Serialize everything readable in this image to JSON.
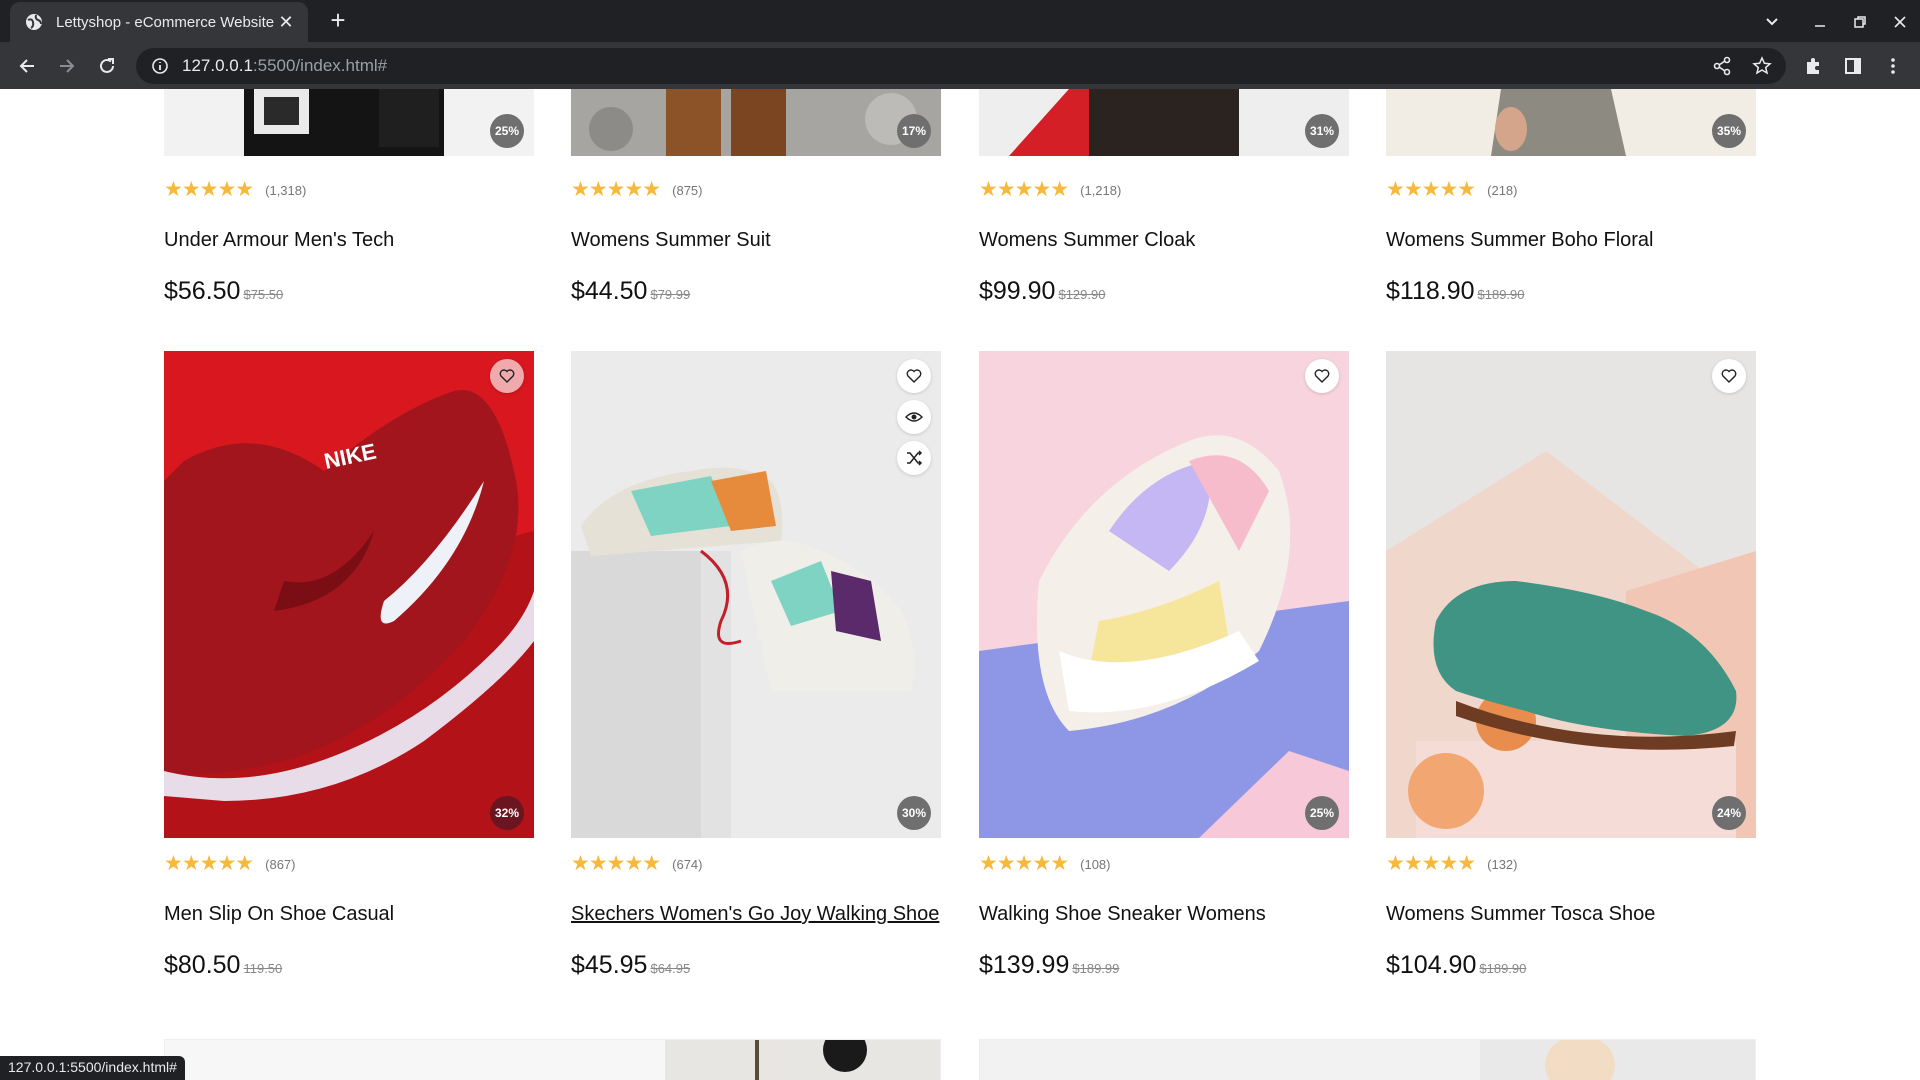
{
  "browser": {
    "tab_title": "Lettyshop - eCommerce Website",
    "url_host": "127.0.0.1",
    "url_rest": ":5500/index.html#",
    "status_url": "127.0.0.1:5500/index.html#"
  },
  "products_top": [
    {
      "reviews": "(1,318)",
      "title": "Under Armour Men's Tech",
      "price": "$56.50",
      "old_price": "$75.50",
      "discount": "25%",
      "badge_color": "#6f6f6f"
    },
    {
      "reviews": "(875)",
      "title": "Womens Summer Suit",
      "price": "$44.50",
      "old_price": "$79.99",
      "discount": "17%",
      "badge_color": "#6f6f6f"
    },
    {
      "reviews": "(1,218)",
      "title": "Womens Summer Cloak",
      "price": "$99.90",
      "old_price": "$129.90",
      "discount": "31%",
      "badge_color": "#6f6f6f"
    },
    {
      "reviews": "(218)",
      "title": "Womens Summer Boho Floral",
      "price": "$118.90",
      "old_price": "$189.90",
      "discount": "35%",
      "badge_color": "#6f6f6f"
    }
  ],
  "products_bottom": [
    {
      "reviews": "(867)",
      "title": "Men Slip On Shoe Casual",
      "price": "$80.50",
      "old_price": "119.50",
      "discount": "32%",
      "badge_color": "#6b1520"
    },
    {
      "reviews": "(674)",
      "title": "Skechers Women's Go Joy Walking Shoe",
      "price": "$45.95",
      "old_price": "$64.95",
      "discount": "30%",
      "badge_color": "#6f6f6f"
    },
    {
      "reviews": "(108)",
      "title": "Walking Shoe Sneaker Womens",
      "price": "$139.99",
      "old_price": "$189.99",
      "discount": "25%",
      "badge_color": "#6f6f6f"
    },
    {
      "reviews": "(132)",
      "title": "Womens Summer Tosca Shoe",
      "price": "$104.90",
      "old_price": "$189.90",
      "discount": "24%",
      "badge_color": "#6f6f6f"
    }
  ],
  "colors": {
    "star": "#f6b93b",
    "chrome_dark": "#202124",
    "chrome_mid": "#35363a"
  },
  "icons": [
    "globe-icon",
    "close-icon",
    "plus-icon",
    "chevron-down-icon",
    "minimize-icon",
    "restore-icon",
    "back-icon",
    "forward-icon",
    "reload-icon",
    "info-icon",
    "share-icon",
    "star-icon",
    "extensions-icon",
    "sidepanel-icon",
    "menu-icon",
    "heart-icon",
    "eye-icon",
    "shuffle-icon"
  ]
}
